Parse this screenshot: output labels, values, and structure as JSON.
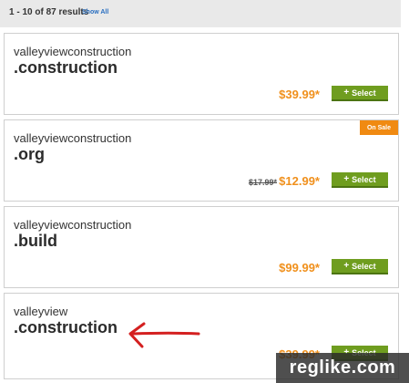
{
  "results": {
    "count_text": "1 - 10 of 87 results",
    "show_all_label": "Show All"
  },
  "results_list": [
    {
      "name": "valleyviewconstruction",
      "tld": ".construction",
      "price": "$39.99*",
      "select_label": "Select"
    },
    {
      "name": "valleyviewconstruction",
      "tld": ".org",
      "old_price": "$17.99*",
      "price": "$12.99*",
      "select_label": "Select",
      "badge": "On Sale"
    },
    {
      "name": "valleyviewconstruction",
      "tld": ".build",
      "price": "$99.99*",
      "select_label": "Select"
    },
    {
      "name": "valleyview",
      "tld": ".construction",
      "price": "$39.99*",
      "select_label": "Select"
    }
  ],
  "colors": {
    "price": "#f0901c",
    "select_button": "#6f9d1f",
    "badge": "#f08a12",
    "arrow": "#d42020",
    "link": "#2a6fc0"
  },
  "icons": {
    "plus": "plus-icon",
    "annotation": "red-arrow-icon"
  },
  "watermark": "reglike.com"
}
